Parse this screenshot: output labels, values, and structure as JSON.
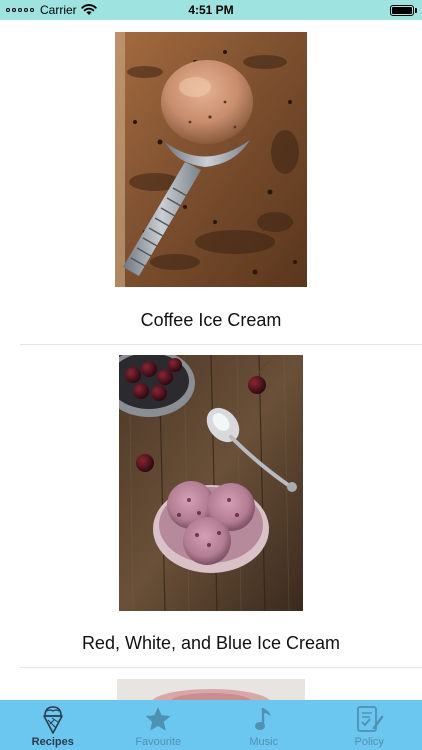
{
  "status_bar": {
    "carrier": "Carrier",
    "time": "4:51 PM"
  },
  "recipes": [
    {
      "title": "Coffee Ice Cream",
      "image": "coffee-ice-cream-photo"
    },
    {
      "title": "Red, White, and Blue Ice Cream",
      "image": "cherry-ice-cream-photo"
    },
    {
      "title": "",
      "image": "partial-next-recipe-photo"
    }
  ],
  "tab_bar": {
    "tabs": [
      {
        "label": "Recipes",
        "icon": "ice-cream-cone-icon",
        "active": true
      },
      {
        "label": "Favourite",
        "icon": "star-icon",
        "active": false
      },
      {
        "label": "Music",
        "icon": "music-note-icon",
        "active": false
      },
      {
        "label": "Policy",
        "icon": "policy-document-icon",
        "active": false
      }
    ]
  },
  "colors": {
    "status_bar": "#9ee3df",
    "tab_bar": "#6cc7f0",
    "tab_active": "#2b3b4c",
    "tab_inactive": "#4f91b3"
  }
}
